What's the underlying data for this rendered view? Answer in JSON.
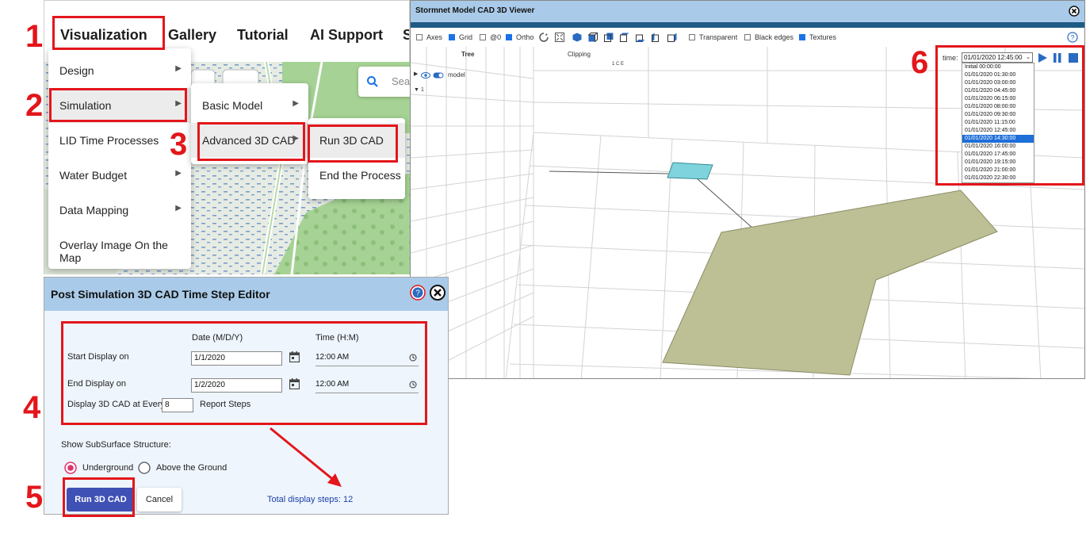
{
  "nav": {
    "items": [
      "Visualization",
      "Gallery",
      "Tutorial",
      "AI Support",
      "S"
    ]
  },
  "map_search": {
    "placeholder": "Sea"
  },
  "menu_main": {
    "items": [
      {
        "label": "Design",
        "submenu": true
      },
      {
        "label": "Simulation",
        "submenu": true
      },
      {
        "label": "LID Time Processes",
        "submenu": false
      },
      {
        "label": "Water Budget",
        "submenu": true
      },
      {
        "label": "Data Mapping",
        "submenu": true
      },
      {
        "label": "Overlay Image On the Map",
        "submenu": false
      }
    ]
  },
  "menu_sim": {
    "items": [
      {
        "label": "Basic Model",
        "submenu": true
      },
      {
        "label": "Advanced 3D CAD",
        "submenu": true
      }
    ]
  },
  "menu_cad": {
    "items": [
      {
        "label": "Run 3D CAD"
      },
      {
        "label": "End the Process"
      }
    ]
  },
  "steps": [
    "1",
    "2",
    "3",
    "4",
    "5",
    "6"
  ],
  "viewer": {
    "title": "Stormnet Model CAD 3D Viewer",
    "toolbar": [
      {
        "label": "Axes",
        "checked": false
      },
      {
        "label": "Grid",
        "checked": true
      },
      {
        "label": "@0",
        "checked": false
      },
      {
        "label": "Ortho",
        "checked": true
      }
    ],
    "toolbar2": [
      {
        "label": "Transparent",
        "checked": false
      },
      {
        "label": "Black edges",
        "checked": false
      },
      {
        "label": "Textures",
        "checked": true
      }
    ],
    "tree_label": "Tree",
    "clipping_label": "Clipping",
    "clip_axes": "1 C E",
    "model_label": "model",
    "node_label": "1",
    "time_label": "time:",
    "time_selected": "01/01/2020 12:45:00",
    "time_options": [
      "Initial 00:00:00",
      "01/01/2020 01:30:00",
      "01/01/2020 03:00:00",
      "01/01/2020 04:45:00",
      "01/01/2020 06:15:00",
      "01/01/2020 08:00:00",
      "01/01/2020 09:30:00",
      "01/01/2020 11:15:00",
      "01/01/2020 12:45:00",
      "01/01/2020 14:30:00",
      "01/01/2020 16:00:00",
      "01/01/2020 17:45:00",
      "01/01/2020 19:15:00",
      "01/01/2020 21:00:00",
      "01/01/2020 22:30:00"
    ],
    "highlighted_option": 9
  },
  "editor": {
    "title": "Post Simulation 3D CAD Time Step Editor",
    "col_date": "Date (M/D/Y)",
    "col_time": "Time (H:M)",
    "start_label": "Start Display on",
    "start_date": "1/1/2020",
    "start_time": "12:00 AM",
    "end_label": "End Display on",
    "end_date": "1/2/2020",
    "end_time": "12:00 AM",
    "every_label": "Display 3D CAD at Every",
    "every_value": "8",
    "report_steps": "Report Steps",
    "subsurface_label": "Show SubSurface Structure:",
    "radio_underground": "Underground",
    "radio_above": "Above the Ground",
    "run_button": "Run 3D CAD",
    "cancel_button": "Cancel",
    "total_steps": "Total display steps: 12"
  },
  "colors": {
    "accent_red": "#e3161b",
    "header_blue": "#a9cbe9",
    "run_button": "#3f51b5",
    "total_text": "#1a3fa8",
    "model_surface": "#bdbf95"
  }
}
